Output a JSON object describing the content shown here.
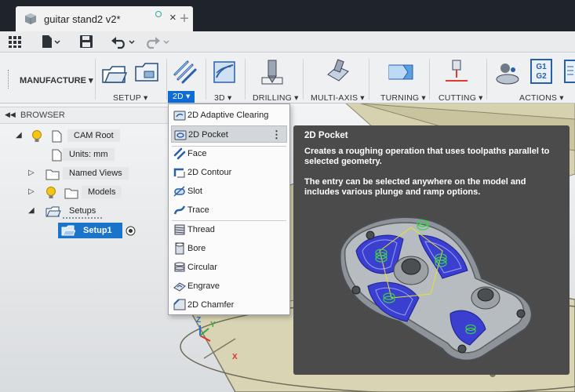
{
  "window": {
    "doc_title": "guitar stand2 v2*",
    "close_glyph": "×",
    "new_tab_glyph": "+"
  },
  "qat": {
    "icons": [
      "grid-menu-icon",
      "file-icon",
      "save-icon",
      "undo-icon",
      "redo-icon"
    ]
  },
  "ribbon": {
    "workspace": "MANUFACTURE",
    "groups": {
      "setup": "SETUP",
      "two_d": "2D",
      "three_d": "3D",
      "drilling": "DRILLING",
      "multi_axis": "MULTI-AXIS",
      "turning": "TURNING",
      "cutting": "CUTTING",
      "actions": "ACTIONS"
    },
    "g1g2": [
      "G1",
      "G2"
    ],
    "active_color": "#0f6bd6"
  },
  "browser": {
    "header": "BROWSER",
    "nodes": {
      "cam_root": "CAM Root",
      "units": "Units: mm",
      "named_views": "Named Views",
      "models": "Models",
      "setups": "Setups",
      "setup1": "Setup1"
    }
  },
  "menu": {
    "items": [
      {
        "label": "2D Adaptive Clearing",
        "icon": "adaptive-clearing-icon"
      },
      {
        "label": "2D Pocket",
        "icon": "pocket-icon"
      },
      {
        "label": "Face",
        "icon": "face-icon"
      },
      {
        "label": "2D Contour",
        "icon": "contour-icon"
      },
      {
        "label": "Slot",
        "icon": "slot-icon"
      },
      {
        "label": "Trace",
        "icon": "trace-icon"
      },
      {
        "label": "Thread",
        "icon": "thread-icon"
      },
      {
        "label": "Bore",
        "icon": "bore-icon"
      },
      {
        "label": "Circular",
        "icon": "circular-icon"
      },
      {
        "label": "Engrave",
        "icon": "engrave-icon"
      },
      {
        "label": "2D Chamfer",
        "icon": "chamfer-icon"
      }
    ],
    "more_glyph": "⋮"
  },
  "tooltip": {
    "title": "2D Pocket",
    "paragraph1": "Creates a roughing operation that uses toolpaths parallel to selected geometry.",
    "paragraph2": "The entry can be selected anywhere on the model and includes various plunge and ramp options."
  },
  "triad": {
    "x": "X",
    "y": "Y",
    "z": "Z"
  }
}
